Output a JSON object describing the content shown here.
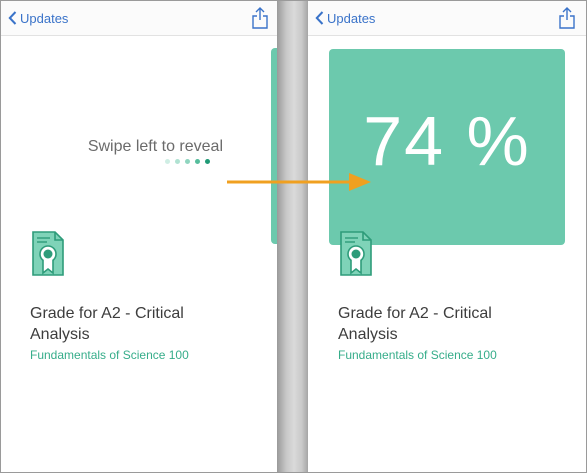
{
  "left": {
    "nav": {
      "back_label": "Updates"
    },
    "swipe_hint": "Swipe left to reveal",
    "item": {
      "title_line1": "Grade for A2 - Critical",
      "title_line2": "Analysis",
      "course": "Fundamentals of Science 100"
    }
  },
  "right": {
    "nav": {
      "back_label": "Updates"
    },
    "grade": "74 %",
    "item": {
      "title_line1": "Grade for A2 - Critical",
      "title_line2": "Analysis",
      "course": "Fundamentals of Science 100"
    }
  },
  "icons": [
    "back-chevron-icon",
    "share-icon",
    "certificate-icon",
    "arrow-right-icon"
  ],
  "colors": {
    "accent": "#6cc9ad",
    "link": "#3a73c9",
    "course_text": "#36ad8a",
    "arrow": "#f0a020"
  }
}
